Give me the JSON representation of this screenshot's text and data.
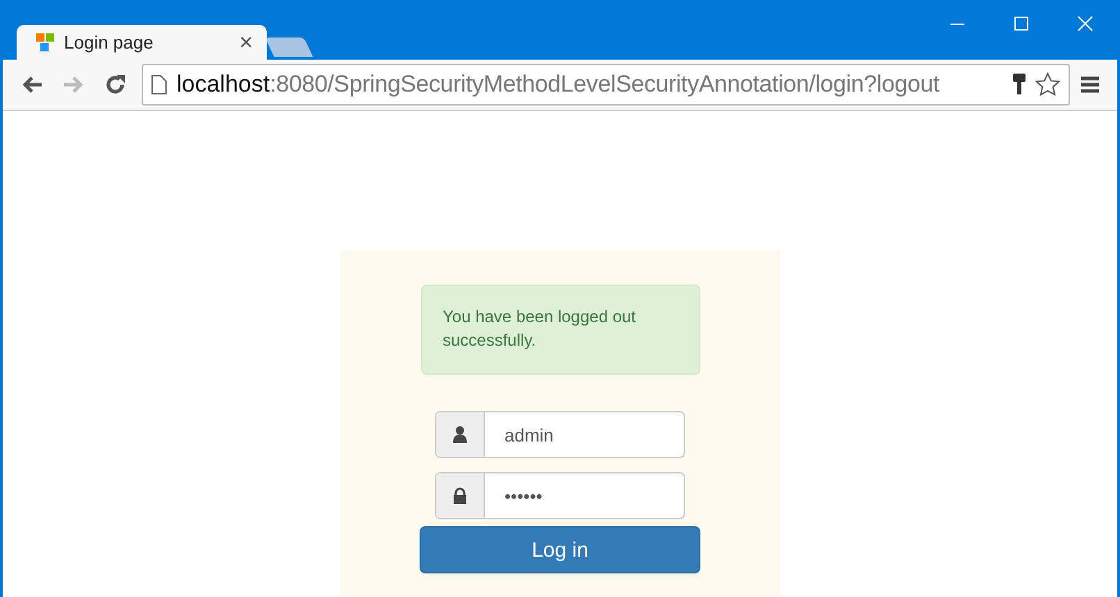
{
  "window": {
    "tabs": [
      {
        "label": "Login page",
        "selected": true,
        "close": "×"
      },
      {
        "selected": false
      }
    ]
  },
  "address_bar": {
    "host": "localhost",
    "rest": ":8080/SpringSecurityMethodLevelSecurityAnnotation/login?logout"
  },
  "login": {
    "alert": "You have been logged out successfully.",
    "fields": [
      {
        "kind": "user",
        "value": "admin"
      },
      {
        "kind": "password",
        "value": "••••••"
      }
    ],
    "button": "Log in"
  }
}
